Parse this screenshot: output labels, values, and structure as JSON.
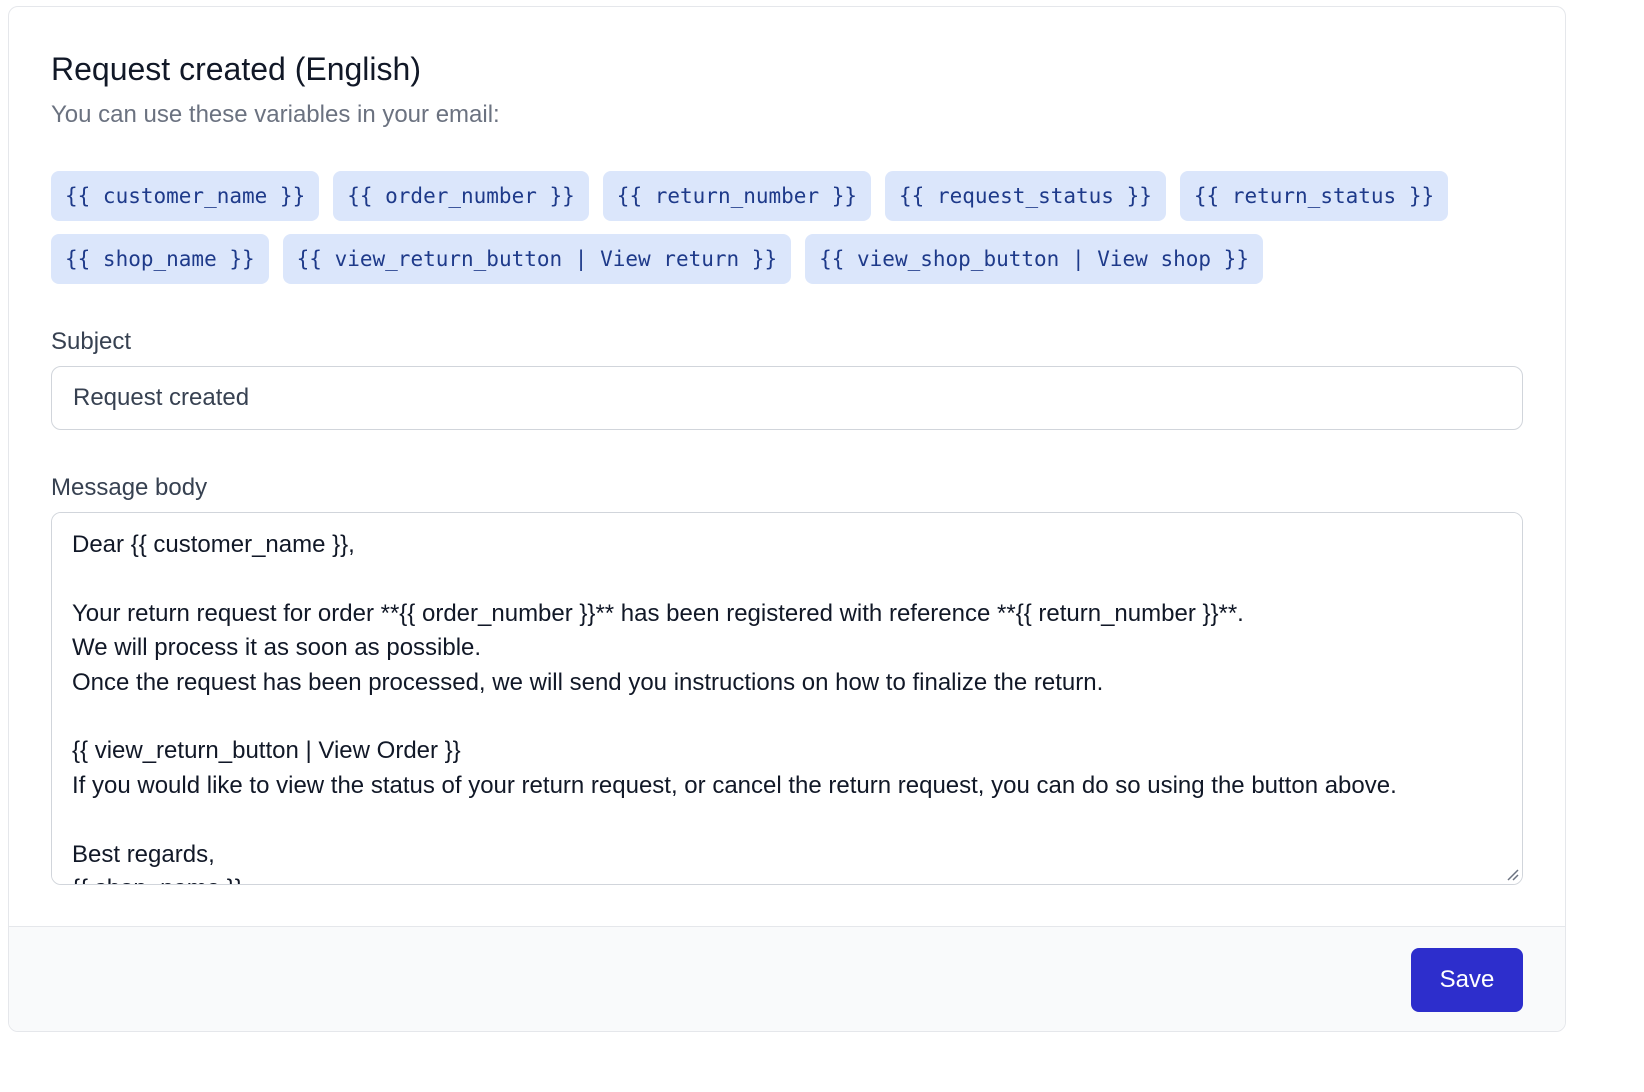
{
  "header": {
    "title": "Request created (English)",
    "subtitle": "You can use these variables in your email:"
  },
  "variables": [
    "{{ customer_name }}",
    "{{ order_number }}",
    "{{ return_number }}",
    "{{ request_status }}",
    "{{ return_status }}",
    "{{ shop_name }}",
    "{{ view_return_button | View return }}",
    "{{ view_shop_button | View shop }}"
  ],
  "subject": {
    "label": "Subject",
    "value": "Request created"
  },
  "message": {
    "label": "Message body",
    "value": "Dear {{ customer_name }},\n\nYour return request for order **{{ order_number }}** has been registered with reference **{{ return_number }}**.\nWe will process it as soon as possible.\nOnce the request has been processed, we will send you instructions on how to finalize the return.\n\n{{ view_return_button | View Order }}\nIf you would like to view the status of your return request, or cancel the return request, you can do so using the button above.\n\nBest regards,\n{{ shop_name }}"
  },
  "footer": {
    "save_label": "Save"
  },
  "colors": {
    "chip_background": "#dbe6fb",
    "chip_text": "#1e3a8a",
    "save_button": "#2d2ecc"
  }
}
